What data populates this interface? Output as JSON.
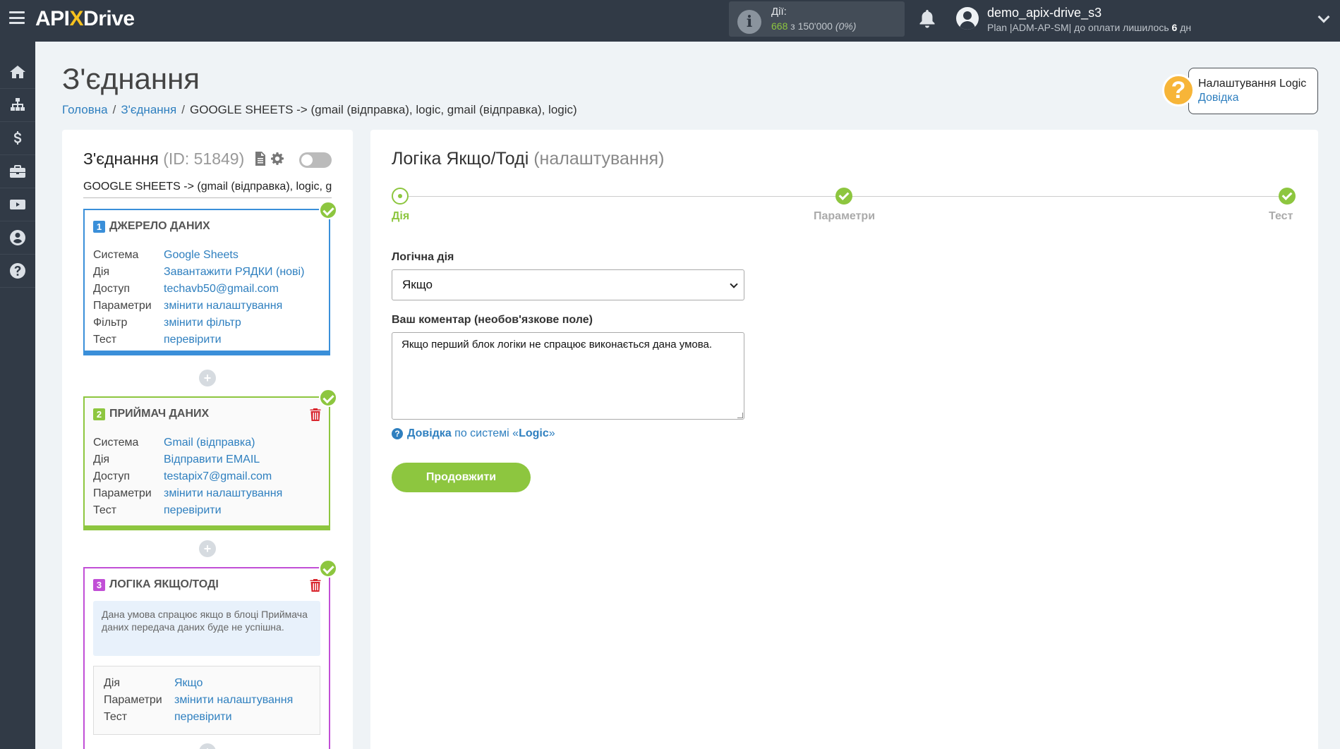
{
  "header": {
    "logo_api": "API",
    "logo_x": "X",
    "logo_drive": "Drive",
    "actions_label": "Дії:",
    "actions_used": "668",
    "actions_of": "з",
    "actions_total": "150'000",
    "actions_percent": "(0%)",
    "user_name": "demo_apix-drive_s3",
    "plan_text": "Plan |ADM-AP-SM| до оплати лишилось",
    "plan_days": "6",
    "plan_days_unit": "дн"
  },
  "sidebar": {
    "items": [
      {
        "icon": "home-icon"
      },
      {
        "icon": "sitemap-icon"
      },
      {
        "icon": "dollar-icon"
      },
      {
        "icon": "briefcase-icon"
      },
      {
        "icon": "youtube-icon"
      },
      {
        "icon": "user-circle-icon"
      },
      {
        "icon": "question-circle-icon"
      }
    ]
  },
  "page": {
    "title": "З'єднання",
    "breadcrumb": {
      "home": "Головна",
      "connections": "З'єднання",
      "current": "GOOGLE SHEETS -> (gmail (відправка), logic, gmail (відправка), logic)"
    },
    "help": {
      "title": "Налаштування Logic",
      "link": "Довідка"
    }
  },
  "connection": {
    "title": "З'єднання",
    "id_text": "(ID: 51849)",
    "name": "GOOGLE SHEETS -> (gmail (відправка), logic, gmail (відправка), logic)",
    "blocks": {
      "source": {
        "num": "1",
        "title": "ДЖЕРЕЛО ДАНИХ",
        "rows": [
          {
            "k": "Система",
            "v": "Google Sheets"
          },
          {
            "k": "Дія",
            "v": "Завантажити РЯДКИ (нові)"
          },
          {
            "k": "Доступ",
            "v": "techavb50@gmail.com"
          },
          {
            "k": "Параметри",
            "v": "змінити налаштування"
          },
          {
            "k": "Фільтр",
            "v": "змінити фільтр"
          },
          {
            "k": "Тест",
            "v": "перевірити"
          }
        ]
      },
      "receiver": {
        "num": "2",
        "title": "ПРИЙМАЧ ДАНИХ",
        "rows": [
          {
            "k": "Система",
            "v": "Gmail (відправка)"
          },
          {
            "k": "Дія",
            "v": "Відправити EMAIL"
          },
          {
            "k": "Доступ",
            "v": "testapix7@gmail.com"
          },
          {
            "k": "Параметри",
            "v": "змінити налаштування"
          },
          {
            "k": "Тест",
            "v": "перевірити"
          }
        ]
      },
      "logic": {
        "num": "3",
        "title": "ЛОГІКА ЯКЩО/ТОДІ",
        "note": "Дана умова спрацює якщо в блоці Приймача даних передача даних буде не успішна.",
        "rows": [
          {
            "k": "Дія",
            "v": "Якщо"
          },
          {
            "k": "Параметри",
            "v": "змінити налаштування"
          },
          {
            "k": "Тест",
            "v": "перевірити"
          }
        ]
      }
    },
    "plus": "+"
  },
  "logic_settings": {
    "title": "Логіка Якщо/Тоді",
    "subtitle": "(налаштування)",
    "steps": [
      "Дія",
      "Параметри",
      "Тест"
    ],
    "action_label": "Логічна дія",
    "action_value": "Якщо",
    "comment_label": "Ваш коментар (необов'язкове поле)",
    "comment_value": "Якщо перший блок логіки не спрацює виконається дана умова.",
    "help_link": "Довідка",
    "help_middle": "по системі «",
    "help_system": "Logic",
    "help_end": "»",
    "continue_button": "Продовжити"
  },
  "colors": {
    "topbar": "#313a46",
    "accent_green": "#8dc63f",
    "link_blue": "#2e7fbf",
    "source_blue": "#3a8fd9",
    "logic_purple": "#c14fd6",
    "help_orange": "#f7b538"
  }
}
